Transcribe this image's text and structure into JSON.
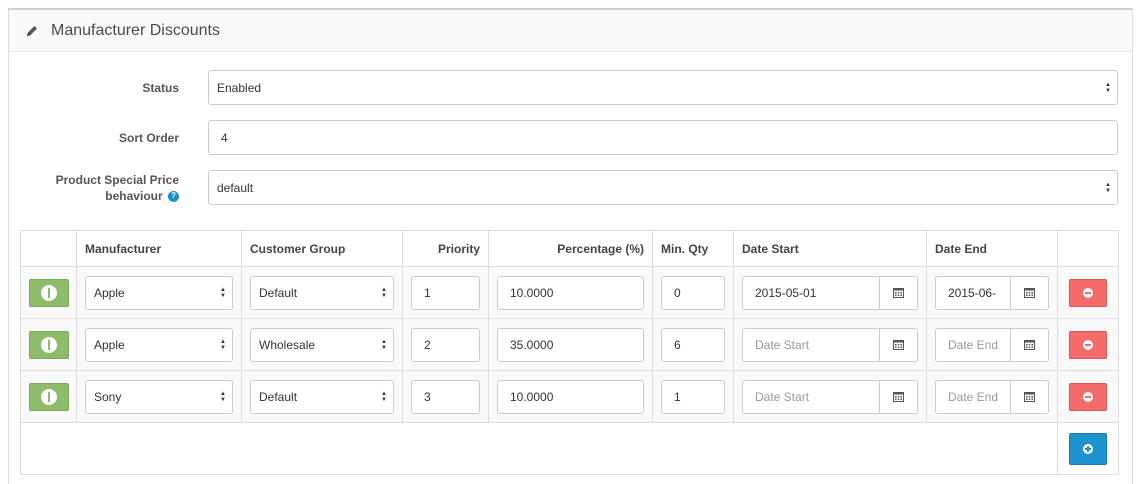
{
  "panel": {
    "title": "Manufacturer Discounts"
  },
  "form": {
    "status_label": "Status",
    "status_value": "Enabled",
    "sort_order_label": "Sort Order",
    "sort_order_value": "4",
    "behaviour_label_line1": "Product Special Price",
    "behaviour_label_line2": "behaviour",
    "behaviour_value": "default"
  },
  "table": {
    "headers": {
      "manufacturer": "Manufacturer",
      "customer_group": "Customer Group",
      "priority": "Priority",
      "percentage": "Percentage (%)",
      "min_qty": "Min. Qty",
      "date_start": "Date Start",
      "date_end": "Date End"
    },
    "rows": [
      {
        "manufacturer": "Apple",
        "customer_group": "Default",
        "priority": "1",
        "percentage": "10.0000",
        "min_qty": "0",
        "date_start": "2015-05-01",
        "date_end": "2015-06-"
      },
      {
        "manufacturer": "Apple",
        "customer_group": "Wholesale",
        "priority": "2",
        "percentage": "35.0000",
        "min_qty": "6",
        "date_start": "",
        "date_end": ""
      },
      {
        "manufacturer": "Sony",
        "customer_group": "Default",
        "priority": "3",
        "percentage": "10.0000",
        "min_qty": "1",
        "date_start": "",
        "date_end": ""
      }
    ],
    "date_start_placeholder": "Date Start",
    "date_end_placeholder": "Date End"
  },
  "colors": {
    "toggle": "#8fbb6c",
    "remove": "#f56b6b",
    "add": "#1e91cf",
    "help": "#1e91cf"
  }
}
